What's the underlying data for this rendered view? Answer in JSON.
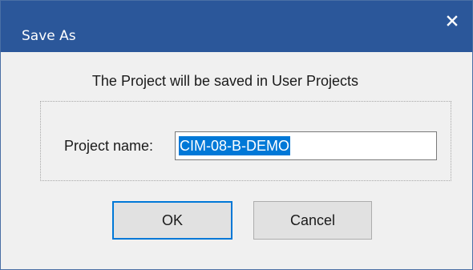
{
  "dialog": {
    "title": "Save As",
    "close_icon": "close-x-icon",
    "message": "The Project will be saved in User Projects",
    "project_name_label": "Project name:",
    "project_name_value": "CIM-08-B-DEMO",
    "ok_label": "OK",
    "cancel_label": "Cancel"
  },
  "colors": {
    "titlebar": "#2b579a",
    "selection": "#0078d7",
    "dialog_bg": "#f0f0f0"
  }
}
